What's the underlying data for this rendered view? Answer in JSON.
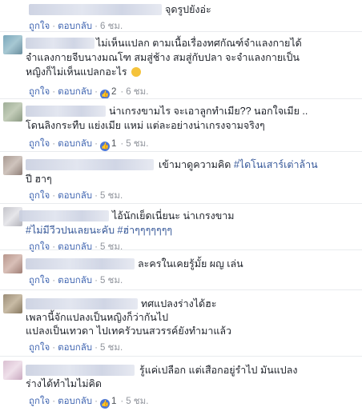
{
  "actions": {
    "like": "ถูกใจ",
    "reply": "ตอบกลับ",
    "dot": "·"
  },
  "comments": [
    {
      "lines": [
        "จุดรูปยังอ่ะ"
      ],
      "time": "6 ชม.",
      "likes": null,
      "avatar_color": "#ffffff"
    },
    {
      "lines": [
        "ไม่เห็นแปลก ตามเนื้อเรื่องทศกัณฑ์จำแลงกายได้",
        "จำแลงกายจีบนางมณโฑ สมสู่ช้าง สมสู่กับปลา จะจำแลงกายเป็น",
        "หญิงก็ไม่เห็นแปลกอะไร"
      ],
      "time": "6 ชม.",
      "likes": "2",
      "avatar_color": "#8fb6c8"
    },
    {
      "lines": [
        "น่าเกรงขามไร จะเอาลูกทำเมีย?? นอกใจเมีย ..",
        "โดนลิงกระทืบ แย่งเมีย แหม่ แต่ละอย่างน่าเกรงจามจริงๆ"
      ],
      "time": "5 ชม.",
      "likes": "1",
      "avatar_color": "#a9b8a0"
    },
    {
      "lines": [
        "เข้ามาดูความคิด",
        "#ไดโนเสาร์เต่าล้าน",
        "ปี ฮาๆ"
      ],
      "time": "5 ชม.",
      "likes": null,
      "avatar_color": "#b7aba3"
    },
    {
      "lines": [
        "ไอ้นักเย็ดเนี่ยนะ น่าเกรงขาม",
        "#ไม่มีวีวปนเลยนะคับ",
        "#ฮ่าๆๆๆๆๆๆๆ"
      ],
      "time": "5 ชม.",
      "likes": null,
      "avatar_color": "#c9c9cf"
    },
    {
      "lines": [
        "ละครในเคยรู้มั้ย ผญ เล่น"
      ],
      "time": "5 ชม.",
      "likes": null,
      "avatar_color": "#c2a39a"
    },
    {
      "lines": [
        "ทศแปลงร่างได้ฮะ",
        "เพลานี้จักแปลงเป็นหญิงก็ว่ากันไป",
        "แปลงเป็นเทวดา ไปเทครัวบนสวรรค์ยังทำมาแล้ว"
      ],
      "time": "5 ชม.",
      "likes": null,
      "avatar_color": "#a89a86"
    },
    {
      "lines": [
        "รู้แค่เปลือก แต่เสือกอยู่รำไป มันแปลง",
        "ร่างได้ทำไมไม่คิด"
      ],
      "time": "5 ชม.",
      "likes": "1",
      "avatar_color": "#dcc6d6"
    }
  ]
}
